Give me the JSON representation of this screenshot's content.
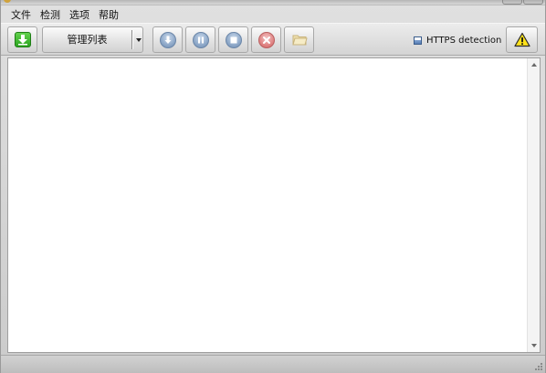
{
  "menubar": {
    "items": [
      {
        "label": "文件"
      },
      {
        "label": "检测"
      },
      {
        "label": "选项"
      },
      {
        "label": "帮助"
      }
    ]
  },
  "toolbar": {
    "download_icon": "download-arrow-icon",
    "list_combo": {
      "label": "管理列表"
    },
    "buttons": [
      {
        "icon": "download-circle-icon"
      },
      {
        "icon": "pause-icon"
      },
      {
        "icon": "stop-icon"
      },
      {
        "icon": "delete-icon"
      },
      {
        "icon": "browse-folder-icon"
      }
    ],
    "https_detection": {
      "label": "HTTPS detection"
    },
    "warning_icon": "warning-icon"
  },
  "colors": {
    "accent_green": "#2aa41e",
    "button_blue": "#8ea8c8",
    "button_red": "#e08585",
    "warning_yellow": "#ffe21a"
  }
}
